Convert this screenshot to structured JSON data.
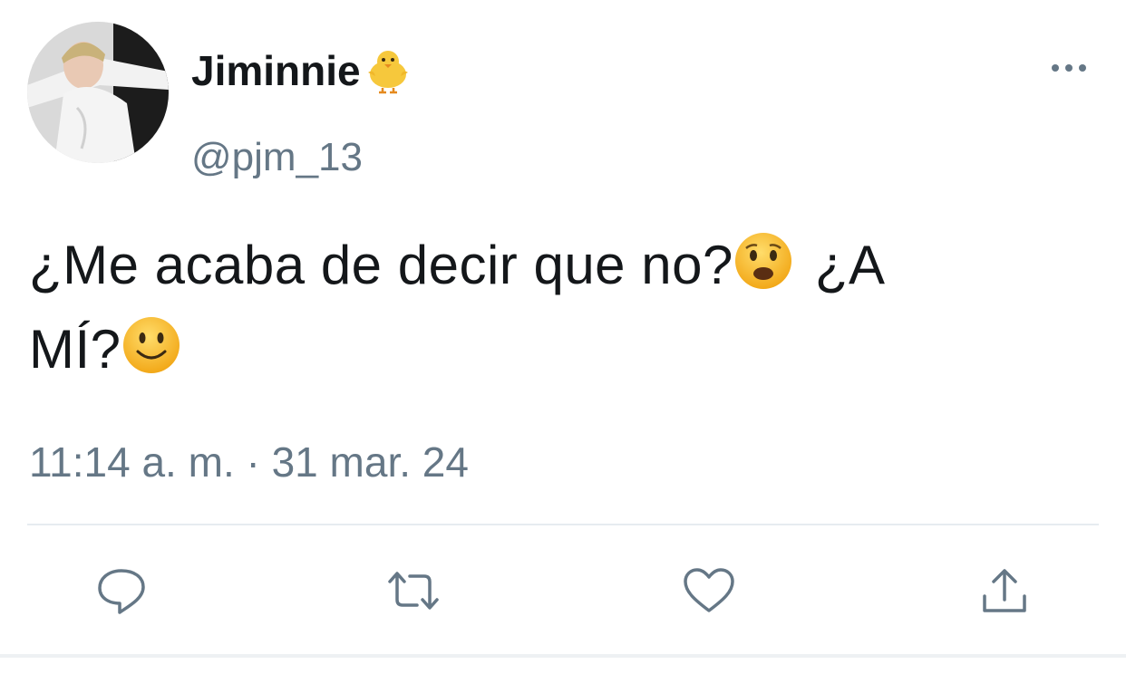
{
  "tweet": {
    "author": {
      "display_name": "Jiminnie",
      "handle": "@pjm_13",
      "name_emoji": "baby-chick-icon"
    },
    "text_line1": "¿Me acaba de decir que no?",
    "text_line1_tail": "¿A",
    "text_line2": "MÍ?",
    "emojis": [
      "frowning-face-icon",
      "slightly-smiling-face-icon"
    ],
    "timestamp": "11:14 a. m. · 31 mar. 24"
  },
  "actions": [
    "reply-icon",
    "retweet-icon",
    "like-icon",
    "share-icon"
  ],
  "colors": {
    "text": "#14171a",
    "secondary": "#657786",
    "icon": "#657786",
    "divider": "#e6ecf0"
  }
}
